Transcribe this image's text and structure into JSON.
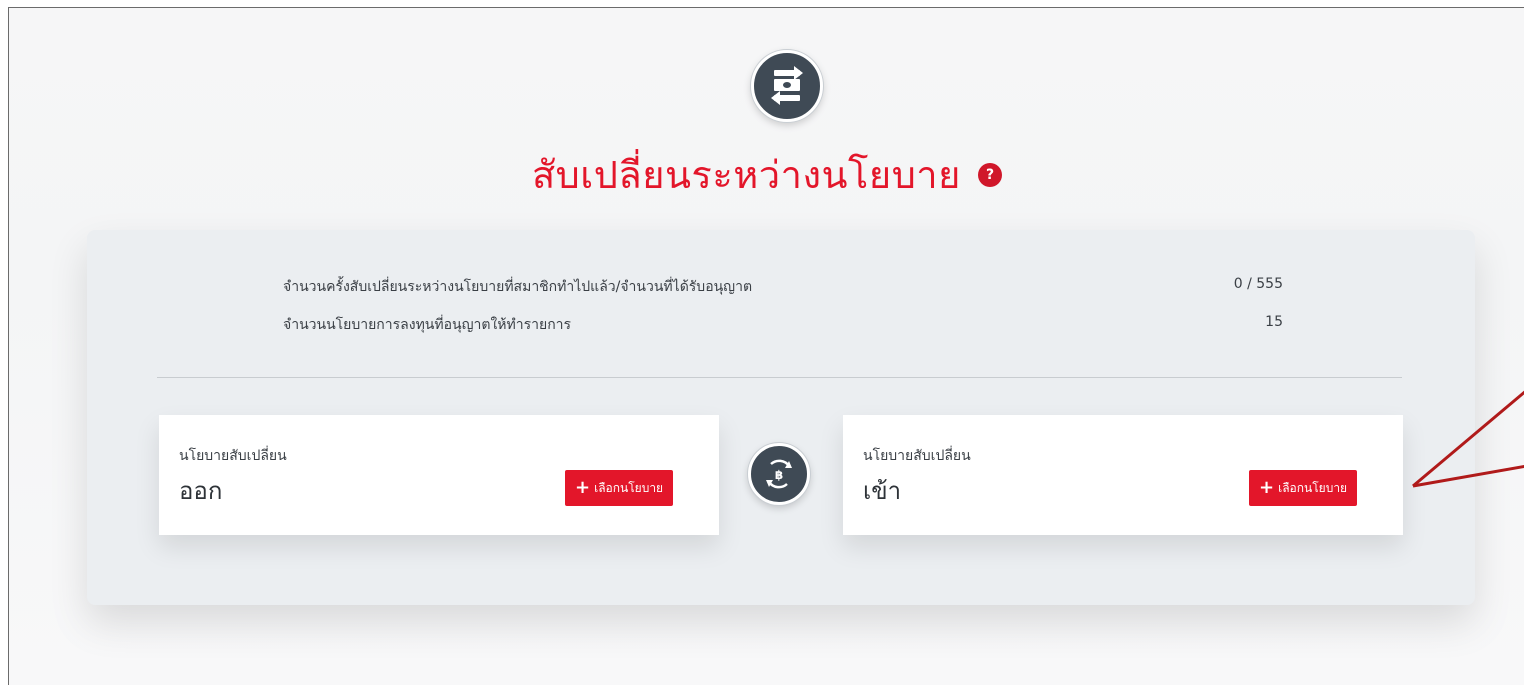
{
  "header": {
    "title": "สับเปลี่ยนระหว่างนโยบาย",
    "help_icon": "?",
    "top_icon": "fund-switch-icon"
  },
  "stats": [
    {
      "label": "จำนวนครั้งสับเปลี่ยนระหว่างนโยบายที่สมาชิกทำไปแล้ว/จำนวนที่ได้รับอนุญาต",
      "value": "0 / 555"
    },
    {
      "label": "จำนวนนโยบายการลงทุนที่อนุญาตให้ทำรายการ",
      "value": "15"
    }
  ],
  "switch_out": {
    "sub_label": "นโยบายสับเปลี่ยน",
    "direction": "ออก",
    "button_plus": "+",
    "button_label": "เลือกนโยบาย"
  },
  "switch_in": {
    "sub_label": "นโยบายสับเปลี่ยน",
    "direction": "เข้า",
    "button_plus": "+",
    "button_label": "เลือกนโยบาย"
  },
  "colors": {
    "accent": "#e3162a",
    "icon_bg": "#3f4a55",
    "panel_bg": "#ebeef1",
    "callout": "#b01a1a"
  }
}
